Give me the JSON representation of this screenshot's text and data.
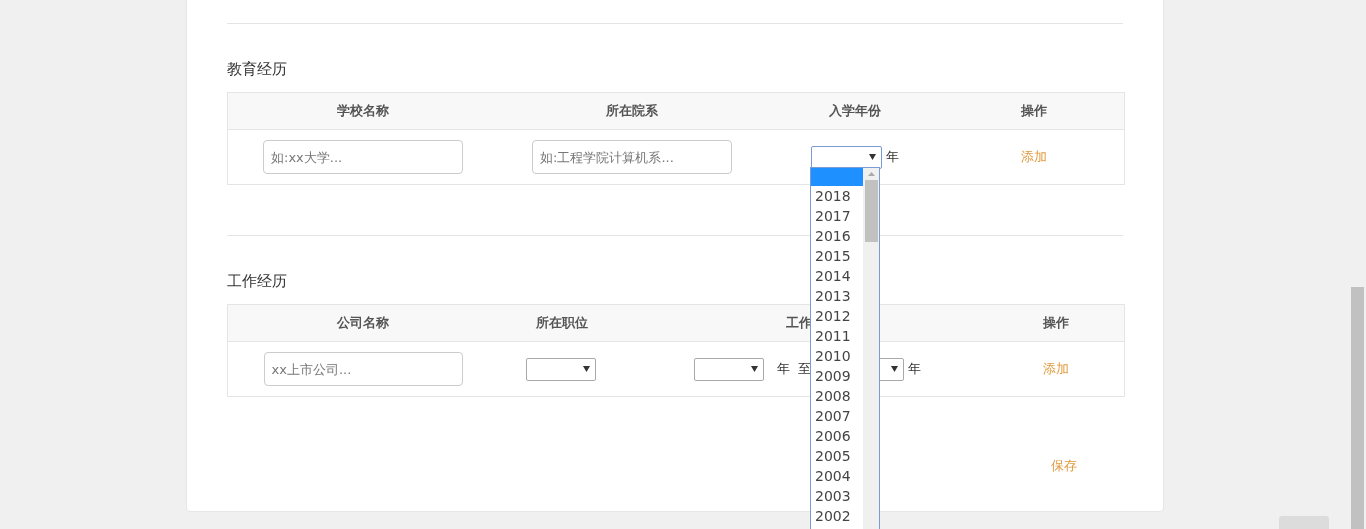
{
  "education": {
    "title": "教育经历",
    "columns": [
      "学校名称",
      "所在院系",
      "入学年份",
      "操作"
    ],
    "row": {
      "school_placeholder": "如:xx大学...",
      "department_placeholder": "如:工程学院计算机系...",
      "year_unit": "年",
      "action": "添加"
    },
    "year_dropdown": {
      "blank_option_selected": true,
      "options": [
        "2018",
        "2017",
        "2016",
        "2015",
        "2014",
        "2013",
        "2012",
        "2011",
        "2010",
        "2009",
        "2008",
        "2007",
        "2006",
        "2005",
        "2004",
        "2003",
        "2002"
      ]
    }
  },
  "work": {
    "title": "工作经历",
    "columns": [
      "公司名称",
      "所在职位",
      "工作",
      "操作"
    ],
    "row": {
      "company_placeholder": "xx上市公司...",
      "start_unit": "年",
      "to": "至",
      "end_unit": "年",
      "action": "添加"
    }
  },
  "save": "保存"
}
